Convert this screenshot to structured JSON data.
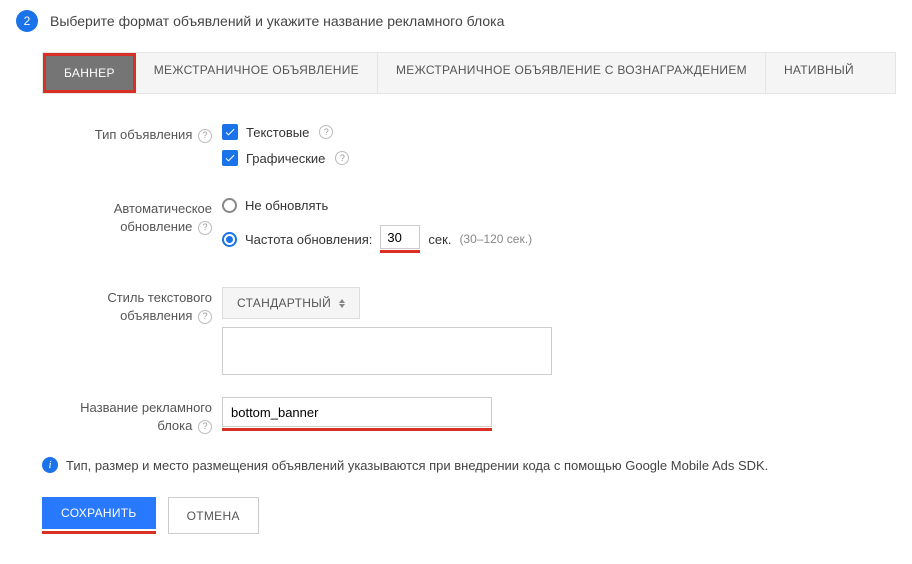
{
  "step": {
    "number": "2",
    "title": "Выберите формат объявлений и укажите название рекламного блока"
  },
  "tabs": [
    {
      "label": "БАННЕР",
      "active": true,
      "highlight": true
    },
    {
      "label": "МЕЖСТРАНИЧНОЕ ОБЪЯВЛЕНИЕ",
      "active": false
    },
    {
      "label": "МЕЖСТРАНИЧНОЕ ОБЪЯВЛЕНИЕ С ВОЗНАГРАЖДЕНИЕМ",
      "active": false
    },
    {
      "label": "НАТИВНЫЙ",
      "active": false
    }
  ],
  "adType": {
    "label": "Тип объявления",
    "textLabel": "Текстовые",
    "graphicLabel": "Графические"
  },
  "refresh": {
    "label1": "Автоматическое",
    "label2": "обновление",
    "noRefresh": "Не обновлять",
    "rateLabel": "Частота обновления:",
    "value": "30",
    "unit": "сек.",
    "hint": "(30–120 сек.)"
  },
  "style": {
    "label1": "Стиль текстового",
    "label2": "объявления",
    "selected": "СТАНДАРТНЫЙ"
  },
  "name": {
    "label1": "Название рекламного",
    "label2": "блока",
    "value": "bottom_banner"
  },
  "info": "Тип, размер и место размещения объявлений указываются при внедрении кода с помощью Google Mobile Ads SDK.",
  "actions": {
    "save": "СОХРАНИТЬ",
    "cancel": "ОТМЕНА"
  }
}
